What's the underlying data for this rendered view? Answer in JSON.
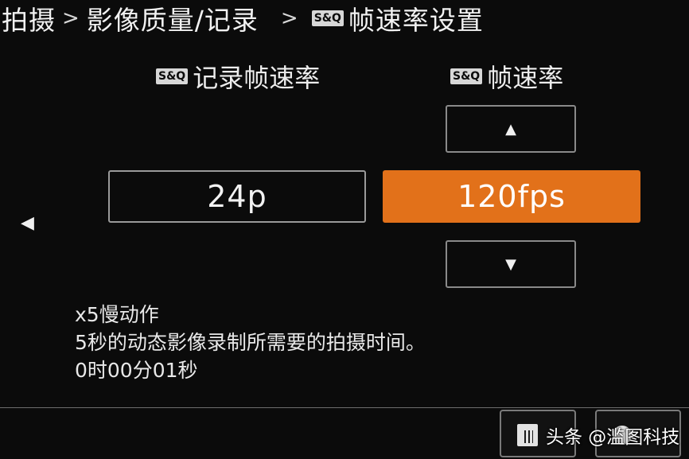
{
  "breadcrumb": {
    "level1": "拍摄",
    "level2": "影像质量/记录",
    "badge": "S&Q",
    "level3": "帧速率设置",
    "separator": ">"
  },
  "columns": {
    "record_frame_rate": {
      "badge": "S&Q",
      "label": "记录帧速率",
      "value": "24p"
    },
    "frame_rate": {
      "badge": "S&Q",
      "label": "帧速率",
      "value": "120fps"
    }
  },
  "controls": {
    "up_glyph": "▲",
    "down_glyph": "▼",
    "left_glyph": "◀"
  },
  "info": {
    "line1": "x5慢动作",
    "line2": "5秒的动态影像录制所需要的拍摄时间。",
    "line3": "0时00分01秒"
  },
  "footer": {
    "delete_icon": "trash-icon",
    "ok_icon": "ok-circle-icon",
    "watermark": "头条 @滥图科技"
  },
  "colors": {
    "accent": "#e2711a",
    "background": "#0b0b0b"
  }
}
